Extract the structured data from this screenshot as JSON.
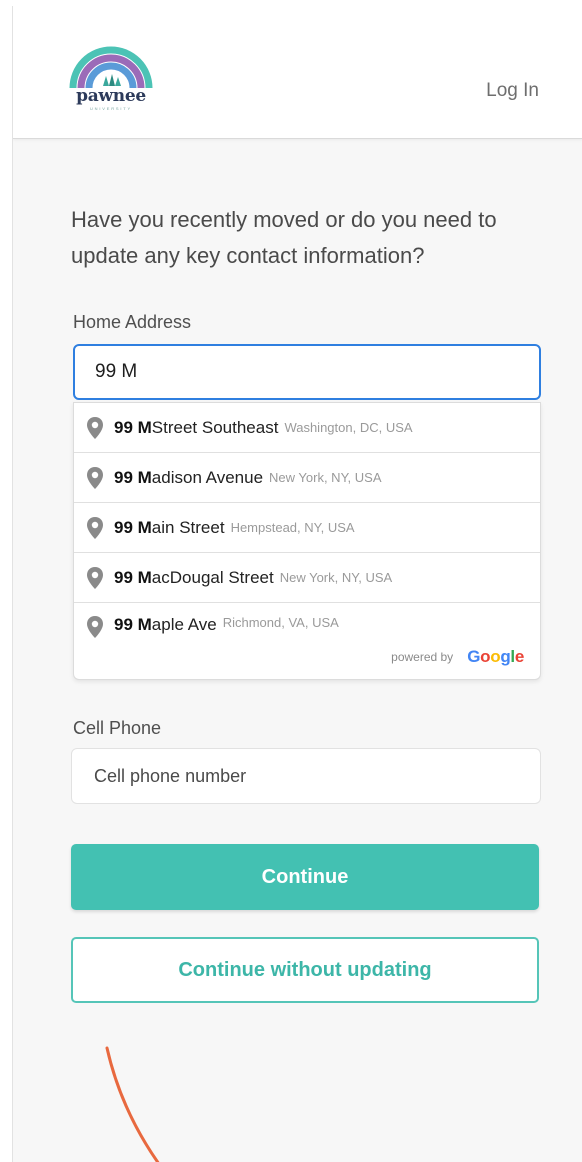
{
  "header": {
    "logo_text": "pawnee",
    "logo_subtext": "UNIVERSITY",
    "login_label": "Log In"
  },
  "form": {
    "question": "Have you recently moved or do you need to update any key contact information?",
    "home_address_label": "Home Address",
    "home_address_value": "99 M",
    "suggestions": [
      {
        "bold": "99 M",
        "rest": " Street Southeast",
        "secondary": "Washington, DC, USA"
      },
      {
        "bold": "99 M",
        "rest": "adison Avenue",
        "secondary": "New York, NY, USA"
      },
      {
        "bold": "99 M",
        "rest": "ain Street",
        "secondary": "Hempstead, NY, USA"
      },
      {
        "bold": "99 M",
        "rest": "acDougal Street",
        "secondary": "New York, NY, USA"
      },
      {
        "bold": "99 M",
        "rest": "aple Ave",
        "secondary": "Richmond, VA, USA"
      }
    ],
    "powered_by": "powered by",
    "google": "Google",
    "cell_phone_label": "Cell Phone",
    "cell_phone_placeholder": "Cell phone number",
    "continue_label": "Continue",
    "continue_without_label": "Continue without updating"
  },
  "colors": {
    "accent": "#43c1b2",
    "focus_border": "#2f7fe0",
    "decor_arc": "#e8693f"
  }
}
